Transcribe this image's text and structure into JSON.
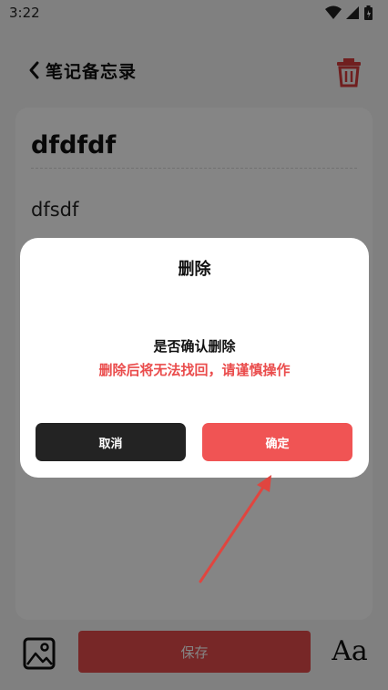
{
  "status_bar": {
    "time": "3:22"
  },
  "header": {
    "title": "笔记备忘录",
    "back_icon": "chevron-left-icon",
    "trash_icon": "trash-icon"
  },
  "note": {
    "title": "dfdfdf",
    "body": "dfsdf"
  },
  "bottom_bar": {
    "save_label": "保存",
    "font_label": "Aa",
    "image_icon": "image-icon"
  },
  "dialog": {
    "title": "删除",
    "message": "是否确认删除",
    "warning": "删除后将无法找回，请谨慎操作",
    "cancel_label": "取消",
    "confirm_label": "确定"
  },
  "colors": {
    "accent_red": "#f05454",
    "warning_red": "#ea4c4c",
    "dark_button": "#232323",
    "overlay": "rgba(0,0,0,0.48)"
  }
}
